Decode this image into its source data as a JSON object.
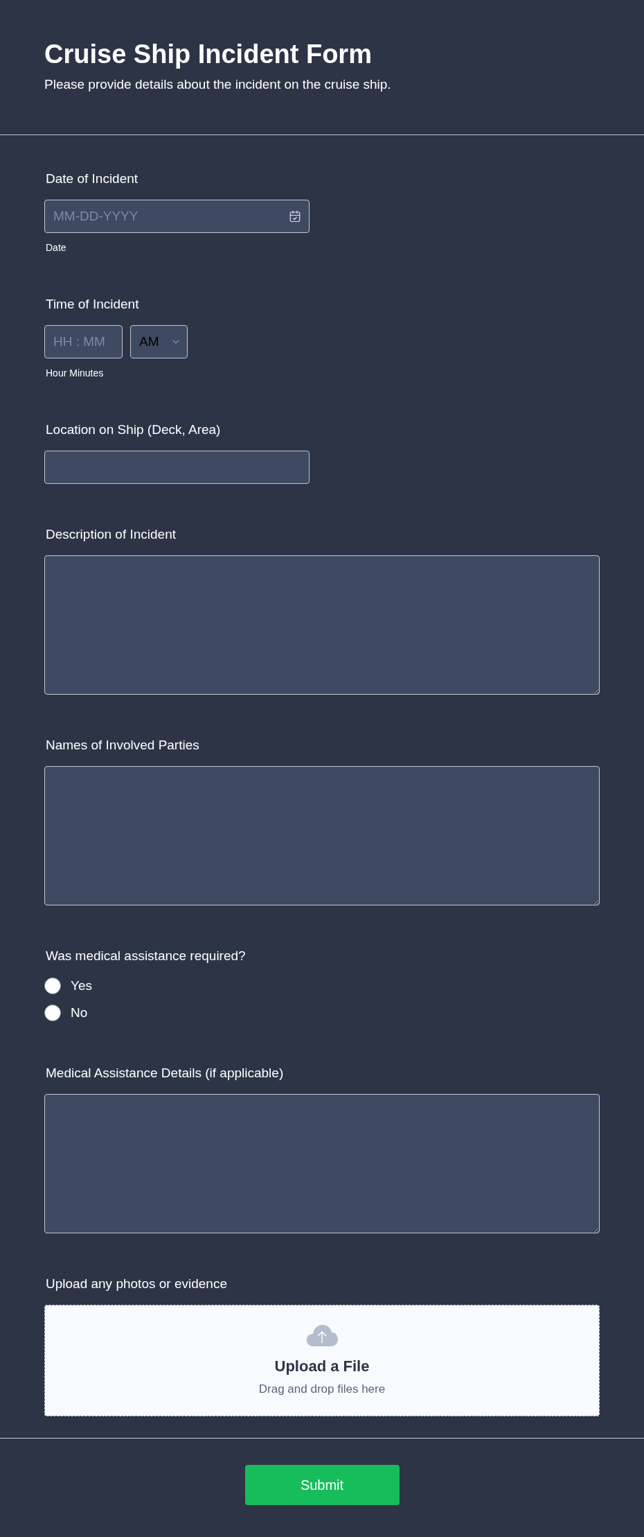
{
  "header": {
    "title": "Cruise Ship Incident Form",
    "subtitle": "Please provide details about the incident on the cruise ship."
  },
  "fields": [
    {
      "kind": "date",
      "label": "Date of Incident",
      "placeholder": "MM-DD-YYYY",
      "sublabel": "Date"
    },
    {
      "kind": "time",
      "label": "Time of Incident",
      "placeholder": "HH : MM",
      "period": "AM",
      "sublabel": "Hour Minutes"
    },
    {
      "kind": "text",
      "label": "Location on Ship (Deck, Area)"
    },
    {
      "kind": "textarea",
      "label": "Description of Incident"
    },
    {
      "kind": "textarea",
      "label": "Names of Involved Parties"
    },
    {
      "kind": "radio",
      "label": "Was medical assistance required?",
      "options": [
        {
          "label": "Yes",
          "selected": false
        },
        {
          "label": "No",
          "selected": false
        }
      ]
    },
    {
      "kind": "textarea",
      "label": "Medical Assistance Details (if applicable)"
    },
    {
      "kind": "upload",
      "label": "Upload any photos or evidence",
      "title": "Upload a File",
      "hint": "Drag and drop files here"
    }
  ],
  "submit": "Submit"
}
